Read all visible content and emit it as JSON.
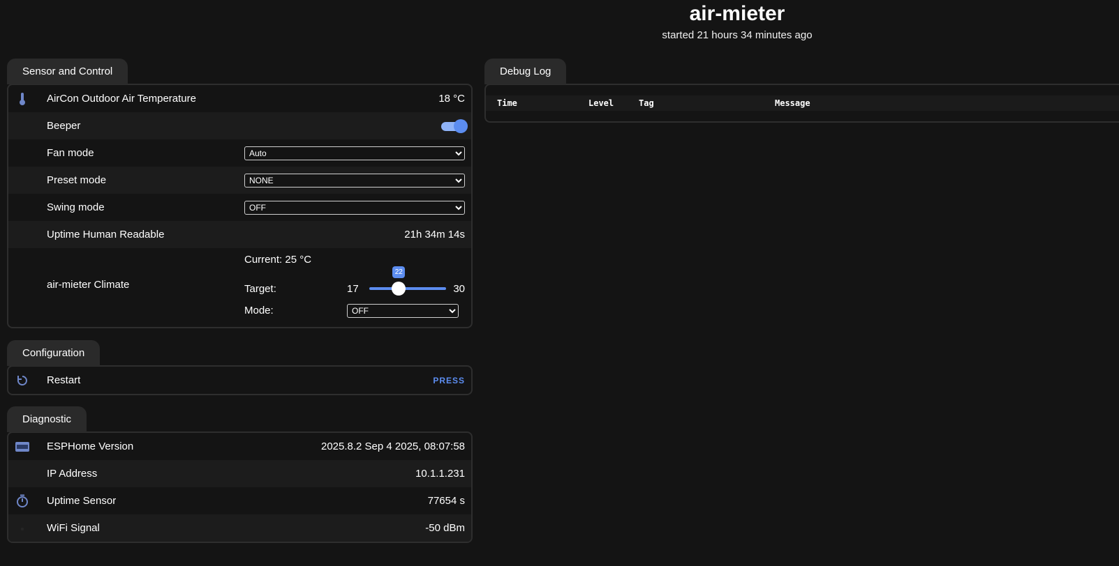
{
  "header": {
    "title": "air-mieter",
    "subtitle": "started 21 hours 34 minutes ago"
  },
  "sensor_control": {
    "tab": "Sensor and Control",
    "temperature": {
      "label": "AirCon Outdoor Air Temperature",
      "value": "18 °C",
      "icon": "thermometer-icon"
    },
    "beeper": {
      "label": "Beeper",
      "on": true
    },
    "fan_mode": {
      "label": "Fan mode",
      "value": "Auto"
    },
    "preset_mode": {
      "label": "Preset mode",
      "value": "NONE"
    },
    "swing_mode": {
      "label": "Swing mode",
      "value": "OFF"
    },
    "uptime_readable": {
      "label": "Uptime Human Readable",
      "value": "21h 34m 14s"
    },
    "climate": {
      "label": "air-mieter Climate",
      "current": "Current: 25 °C",
      "target_label": "Target:",
      "min": "17",
      "max": "30",
      "target_value": "22",
      "target_numeric": 22,
      "min_numeric": 17,
      "max_numeric": 30,
      "mode_label": "Mode:",
      "mode_value": "OFF"
    }
  },
  "configuration": {
    "tab": "Configuration",
    "restart": {
      "label": "Restart",
      "action": "PRESS",
      "icon": "restart-icon"
    }
  },
  "diagnostic": {
    "tab": "Diagnostic",
    "esphome_version": {
      "label": "ESPHome Version",
      "value": "2025.8.2 Sep 4 2025, 08:07:58",
      "icon": "new-badge-icon"
    },
    "ip_address": {
      "label": "IP Address",
      "value": "10.1.1.231"
    },
    "uptime_sensor": {
      "label": "Uptime Sensor",
      "value": "77654 s",
      "icon": "timer-icon"
    },
    "wifi_signal": {
      "label": "WiFi Signal",
      "value": "-50 dBm",
      "icon": "wifi-icon"
    }
  },
  "debug_log": {
    "tab": "Debug Log",
    "columns": [
      "Time",
      "Level",
      "Tag",
      "Message"
    ]
  },
  "colors": {
    "accent": "#5c8df0",
    "background": "#141414",
    "tab": "#2a2a2a"
  }
}
